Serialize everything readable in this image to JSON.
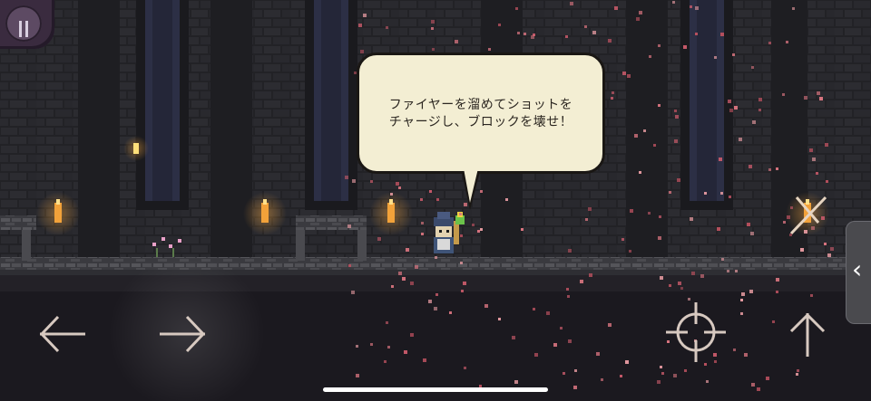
{
  "speech_bubble": {
    "line1": "ファイヤーを溜めてショットを",
    "line2": "チャージし、ブロックを壊せ！"
  },
  "pause_button": {
    "icon": "pause-icon"
  },
  "side_tab": {
    "icon": "chevron-left-icon",
    "glyph": "‹"
  },
  "controls": {
    "move_left": {
      "icon": "arrow-left-icon"
    },
    "move_right": {
      "icon": "arrow-right-icon"
    },
    "aim": {
      "icon": "crosshair-icon"
    },
    "jump": {
      "icon": "arrow-up-icon"
    }
  },
  "colors": {
    "background": "#16141a",
    "brick": "#2a2a2e",
    "floor": "#4d4d52",
    "torch": "#f2a23a",
    "petal": "#d9747f",
    "control": "#d7c9c0",
    "bubble": "#f3eed3"
  }
}
